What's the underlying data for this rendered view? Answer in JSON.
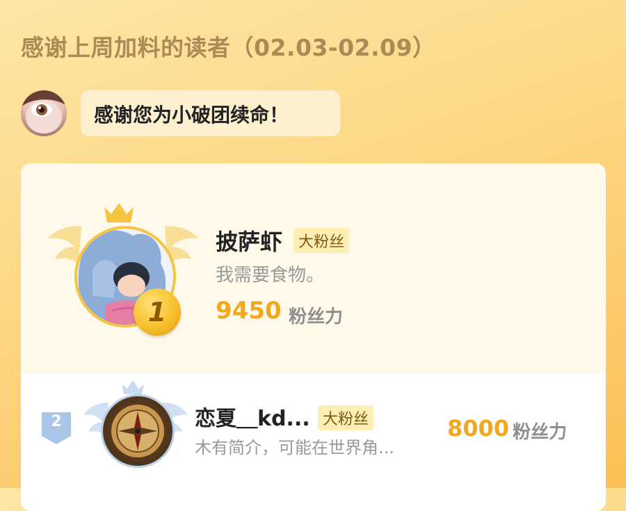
{
  "header": {
    "title": "感谢上周加料的读者（02.03-02.09）"
  },
  "message": {
    "text": "感谢您为小破团续命！"
  },
  "ranking": [
    {
      "rank": "1",
      "name": "披萨虾",
      "badge": "大粉丝",
      "intro": "我需要食物。",
      "score": "9450",
      "unit": "粉丝力"
    },
    {
      "rank": "2",
      "name": "恋夏＿kd...",
      "badge": "大粉丝",
      "intro": "木有简介，可能在世界角...",
      "score": "8000",
      "unit": "粉丝力"
    }
  ],
  "colors": {
    "accent_score": "#f2a81c",
    "title_color": "#ac8a55",
    "badge_bg": "#fdeeb4",
    "gold": "#f5c542",
    "silver": "#b9cfe5"
  },
  "icons": {
    "crown": "crown-icon",
    "wings": "wings-icon",
    "rank_medal": "rank-medal-icon",
    "rank_badge": "rank-badge-icon"
  }
}
